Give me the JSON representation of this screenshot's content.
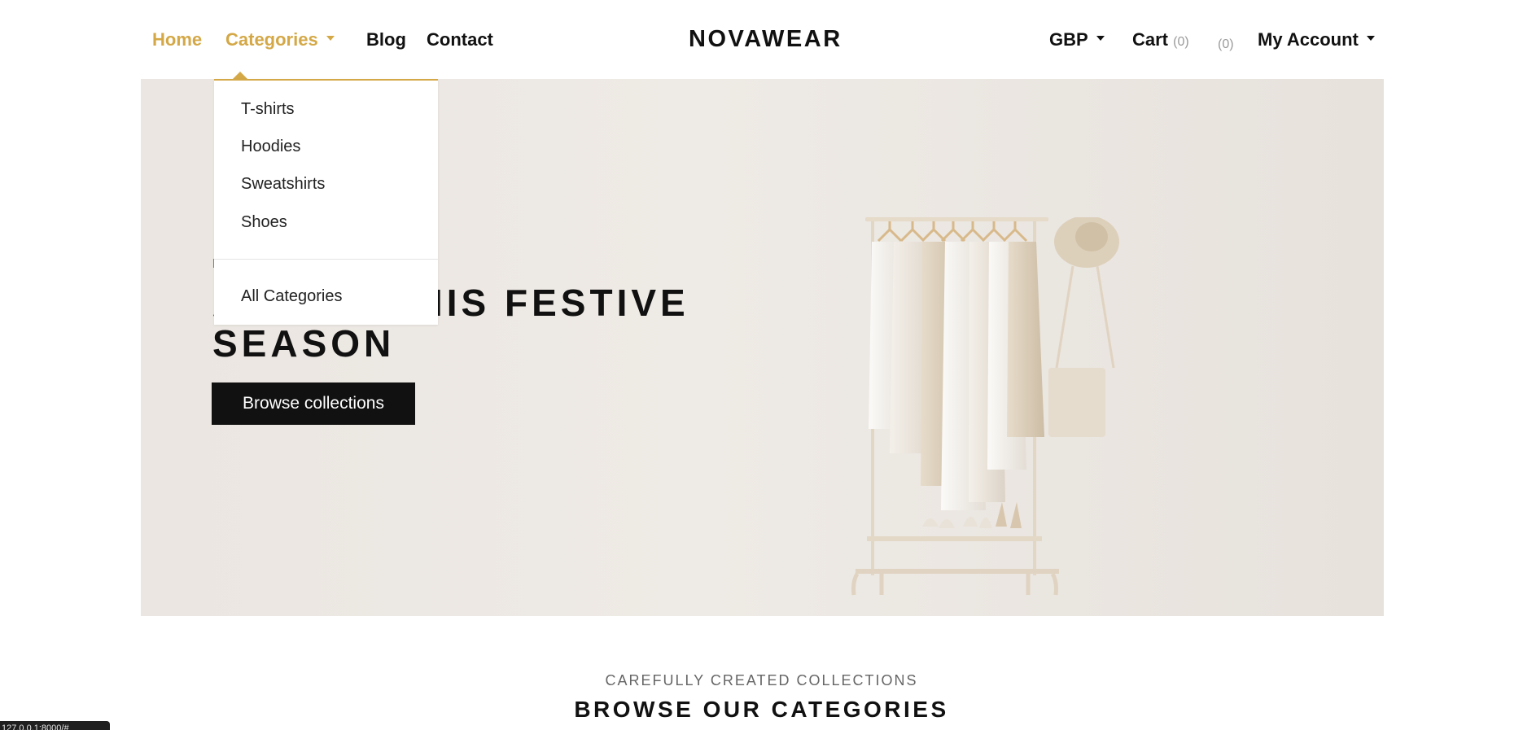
{
  "header": {
    "nav": {
      "home": "Home",
      "categories": "Categories",
      "blog": "Blog",
      "contact": "Contact"
    },
    "brand": "NOVAWEAR",
    "currency": "GBP",
    "cart_label": "Cart",
    "cart_count": "(0)",
    "wishlist_count": "(0)",
    "account_label": "My Account"
  },
  "dropdown": {
    "items": [
      "T-shirts",
      "Hoodies",
      "Sweatshirts",
      "Shoes"
    ],
    "all": "All Categories"
  },
  "hero": {
    "kicker": "M",
    "title_line1": "ACTIVE THIS FESTIVE",
    "title_line2": "SEASON",
    "button": "Browse collections"
  },
  "section": {
    "kicker": "CAREFULLY CREATED COLLECTIONS",
    "title": "BROWSE OUR CATEGORIES"
  },
  "status_bar": "127.0.0.1:8000/#",
  "colors": {
    "accent": "#d4a847",
    "text": "#111111",
    "hero_bg": "#ece7e2",
    "button_bg": "#111111"
  }
}
